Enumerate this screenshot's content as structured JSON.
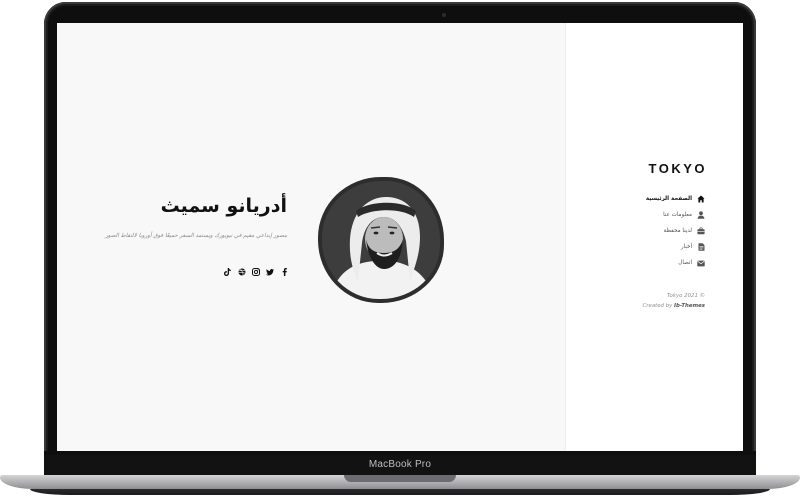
{
  "device": {
    "label": "MacBook Pro"
  },
  "site": {
    "logo": "TOKYO",
    "copyright_line": "Tokyo 2021 ©",
    "created_by_prefix": "Created by",
    "created_by_name": "Ib-Themes"
  },
  "sidebar": {
    "items": [
      {
        "label": "الصفحة الرئيسية",
        "icon": "home-icon",
        "active": true
      },
      {
        "label": "معلومات عنا",
        "icon": "user-icon",
        "active": false
      },
      {
        "label": "لدينا محفظة",
        "icon": "briefcase-icon",
        "active": false
      },
      {
        "label": "أخبار",
        "icon": "document-icon",
        "active": false
      },
      {
        "label": "اتصال",
        "icon": "mail-icon",
        "active": false
      }
    ]
  },
  "hero": {
    "name": "أدريانو سميث",
    "bio": "مصور إبداعي مقيم في نيويورك ويستمد السفر حميعًا فوق أوروبا لالتقاط الصور",
    "socials": [
      {
        "icon": "facebook-icon"
      },
      {
        "icon": "twitter-icon"
      },
      {
        "icon": "instagram-icon"
      },
      {
        "icon": "dribbble-icon"
      },
      {
        "icon": "tiktok-icon"
      }
    ]
  },
  "colors": {
    "main_bg": "#f8f8f8",
    "sidebar_bg": "#ffffff",
    "text_dark": "#111111",
    "text_muted": "#8a8a8a"
  }
}
